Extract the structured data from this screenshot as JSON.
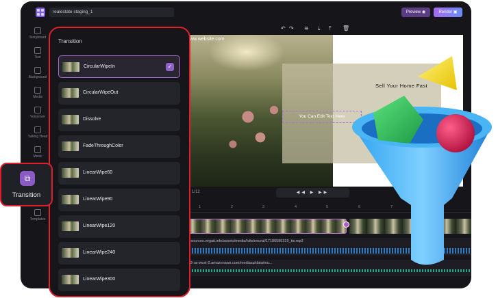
{
  "app": {
    "project_name": "realestate staging_1",
    "preview_label": "Preview",
    "render_label": "Render"
  },
  "rail": [
    {
      "label": "Storyboard",
      "icon": "storyboard-icon"
    },
    {
      "label": "Text",
      "icon": "text-icon"
    },
    {
      "label": "Background",
      "icon": "background-icon"
    },
    {
      "label": "Media",
      "icon": "media-icon"
    },
    {
      "label": "Voiceover",
      "icon": "voiceover-icon"
    },
    {
      "label": "Talking Head",
      "icon": "talking-head-icon"
    },
    {
      "label": "Music",
      "icon": "music-icon"
    },
    {
      "label": "Templates",
      "icon": "templates-icon"
    }
  ],
  "transition_tab": {
    "label": "Transition",
    "icon": "transition-icon"
  },
  "panel": {
    "title": "Transition",
    "items": [
      {
        "label": "CircularWipeIn",
        "selected": true
      },
      {
        "label": "CircularWipeOut",
        "selected": false
      },
      {
        "label": "Dissolve",
        "selected": false
      },
      {
        "label": "FadeThroughColor",
        "selected": false
      },
      {
        "label": "LinearWipe60",
        "selected": false
      },
      {
        "label": "LinearWipe90",
        "selected": false
      },
      {
        "label": "LinearWipe120",
        "selected": false
      },
      {
        "label": "LinearWipe240",
        "selected": false
      },
      {
        "label": "LinearWipe300",
        "selected": false
      }
    ]
  },
  "canvas": {
    "website": "www.website.com",
    "headline": "Sell Your Home Fast",
    "edit_text": "You Can Edit Text Here"
  },
  "player": {
    "page_count": "1/12",
    "controls": "◀◀ ▶ ▶▶"
  },
  "timeline": {
    "ticks": [
      "1",
      "2",
      "3",
      "4",
      "5",
      "6",
      "7",
      "8"
    ],
    "audio1_path": "/resources.vegati.info/assets/media/lvtts/neural/17186586319_tts.mp3",
    "audio2_path": "//s3-us-west-2.amazonaws.com/mediasp/data/mu..."
  },
  "colors": {
    "accent": "#8a5bc4",
    "highlight_border": "#e01f2c",
    "app_bg": "#15151a"
  }
}
